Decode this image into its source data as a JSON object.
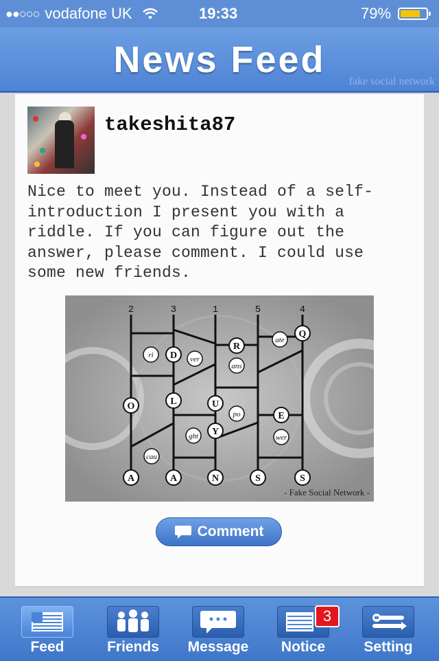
{
  "status_bar": {
    "signal": "●●○○○",
    "carrier": "vodafone UK",
    "time": "19:33",
    "battery": "79%",
    "battery_level": 0.79
  },
  "header": {
    "title": "News Feed",
    "brand": "fake social network"
  },
  "post": {
    "username": "takeshita87",
    "text": "Nice to meet you. Instead of a self-introduction I present you with a riddle. If you can figure out the answer, please comment. I could use some new friends.",
    "comment_label": "Comment",
    "riddle": {
      "top_numbers": [
        "2",
        "3",
        "1",
        "5",
        "4"
      ],
      "bottom_letters": [
        "A",
        "A",
        "N",
        "S",
        "S"
      ],
      "circled": [
        "Q",
        "ate",
        "R",
        "ans",
        "ri",
        "D",
        "ver",
        "O",
        "L",
        "U",
        "po",
        "E",
        "Y",
        "ght",
        "wer",
        "cau"
      ],
      "watermark": "- Fake Social Network -"
    }
  },
  "tabbar": {
    "tabs": [
      {
        "label": "Feed",
        "icon": "newspaper-icon",
        "active": true
      },
      {
        "label": "Friends",
        "icon": "people-icon",
        "active": false
      },
      {
        "label": "Message",
        "icon": "chat-bubble-icon",
        "active": false
      },
      {
        "label": "Notice",
        "icon": "notice-icon",
        "active": false,
        "badge": "3"
      },
      {
        "label": "Setting",
        "icon": "tools-icon",
        "active": false
      }
    ]
  },
  "colors": {
    "header_blue": "#5687d8",
    "badge_red": "#e3161b",
    "battery_yellow": "#f6c400"
  }
}
